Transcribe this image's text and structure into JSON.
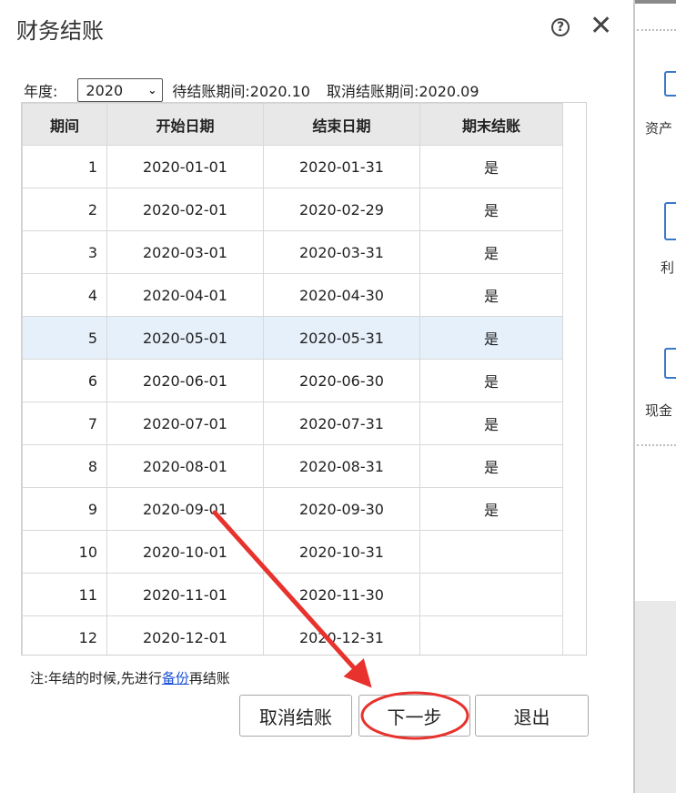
{
  "dialog": {
    "title": "财务结账",
    "help_icon": "question-circle-icon",
    "close_icon": "close-icon",
    "close_glyph": "✕",
    "help_glyph": "?"
  },
  "toolbar": {
    "year_label": "年度:",
    "year_value": "2020",
    "pending_label": "待结账期间:2020.10",
    "cancel_label": "取消结账期间:2020.09"
  },
  "table": {
    "headers": [
      "期间",
      "开始日期",
      "结束日期",
      "期末结账"
    ],
    "rows": [
      {
        "period": "1",
        "start": "2020-01-01",
        "end": "2020-01-31",
        "closed": "是"
      },
      {
        "period": "2",
        "start": "2020-02-01",
        "end": "2020-02-29",
        "closed": "是"
      },
      {
        "period": "3",
        "start": "2020-03-01",
        "end": "2020-03-31",
        "closed": "是"
      },
      {
        "period": "4",
        "start": "2020-04-01",
        "end": "2020-04-30",
        "closed": "是"
      },
      {
        "period": "5",
        "start": "2020-05-01",
        "end": "2020-05-31",
        "closed": "是"
      },
      {
        "period": "6",
        "start": "2020-06-01",
        "end": "2020-06-30",
        "closed": "是"
      },
      {
        "period": "7",
        "start": "2020-07-01",
        "end": "2020-07-31",
        "closed": "是"
      },
      {
        "period": "8",
        "start": "2020-08-01",
        "end": "2020-08-31",
        "closed": "是"
      },
      {
        "period": "9",
        "start": "2020-09-01",
        "end": "2020-09-30",
        "closed": "是"
      },
      {
        "period": "10",
        "start": "2020-10-01",
        "end": "2020-10-31",
        "closed": ""
      },
      {
        "period": "11",
        "start": "2020-11-01",
        "end": "2020-11-30",
        "closed": ""
      },
      {
        "period": "12",
        "start": "2020-12-01",
        "end": "2020-12-31",
        "closed": ""
      }
    ]
  },
  "note": {
    "prefix": "注:年结的时候,先进行",
    "link": "备份",
    "suffix": "再结账"
  },
  "buttons": {
    "cancel_close": "取消结账",
    "next": "下一步",
    "exit": "退出"
  },
  "background": {
    "items": [
      "资产",
      "利",
      "现金"
    ]
  },
  "colors": {
    "annotation_red": "#e8322d",
    "link_blue": "#1a4fd6",
    "selected_row": "#e6f0fb"
  }
}
